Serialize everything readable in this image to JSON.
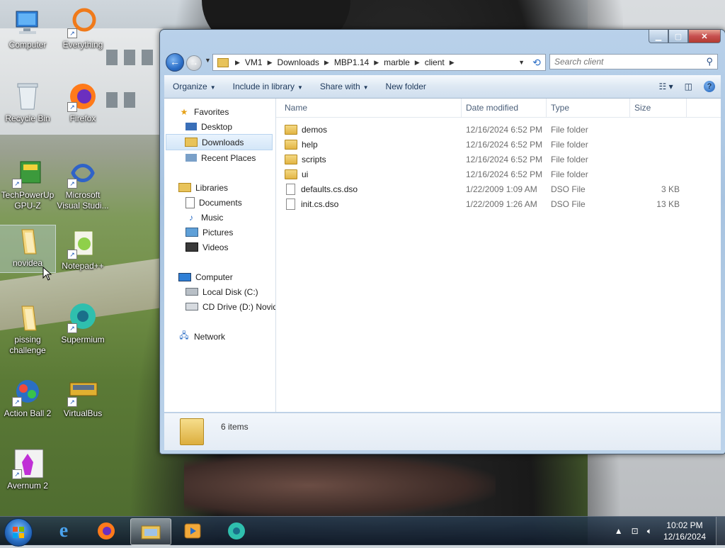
{
  "desktop": {
    "icons": [
      {
        "label": "Computer"
      },
      {
        "label": "Everything"
      },
      {
        "label": "Recycle Bin"
      },
      {
        "label": "Firefox"
      },
      {
        "label": "TechPowerUp GPU-Z"
      },
      {
        "label": "Microsoft Visual Studi..."
      },
      {
        "label": "novidea"
      },
      {
        "label": "Notepad++"
      },
      {
        "label": "pissing challenge"
      },
      {
        "label": "Supermium"
      },
      {
        "label": "Action Ball 2"
      },
      {
        "label": "VirtualBus"
      },
      {
        "label": "Avernum 2"
      }
    ]
  },
  "window": {
    "address": {
      "crumbs": [
        "VM1",
        "Downloads",
        "MBP1.14",
        "marble",
        "client"
      ]
    },
    "search": {
      "placeholder": "Search client"
    },
    "commands": {
      "organize": "Organize",
      "include_in_library": "Include in library",
      "share_with": "Share with",
      "new_folder": "New folder"
    },
    "nav": {
      "favorites": "Favorites",
      "desktop": "Desktop",
      "downloads": "Downloads",
      "recent_places": "Recent Places",
      "libraries": "Libraries",
      "documents": "Documents",
      "music": "Music",
      "pictures": "Pictures",
      "videos": "Videos",
      "computer": "Computer",
      "local_disk": "Local Disk (C:)",
      "cd_drive": "CD Drive (D:) Novide",
      "network": "Network"
    },
    "columns": {
      "name": "Name",
      "date": "Date modified",
      "type": "Type",
      "size": "Size"
    },
    "files": [
      {
        "name": "demos",
        "date": "12/16/2024 6:52 PM",
        "type": "File folder",
        "size": ""
      },
      {
        "name": "help",
        "date": "12/16/2024 6:52 PM",
        "type": "File folder",
        "size": ""
      },
      {
        "name": "scripts",
        "date": "12/16/2024 6:52 PM",
        "type": "File folder",
        "size": ""
      },
      {
        "name": "ui",
        "date": "12/16/2024 6:52 PM",
        "type": "File folder",
        "size": ""
      },
      {
        "name": "defaults.cs.dso",
        "date": "1/22/2009 1:09 AM",
        "type": "DSO File",
        "size": "3 KB"
      },
      {
        "name": "init.cs.dso",
        "date": "1/22/2009 1:26 AM",
        "type": "DSO File",
        "size": "13 KB"
      }
    ],
    "details": {
      "count": "6 items"
    }
  },
  "taskbar": {
    "clock": {
      "time": "10:02 PM",
      "date": "12/16/2024"
    }
  }
}
